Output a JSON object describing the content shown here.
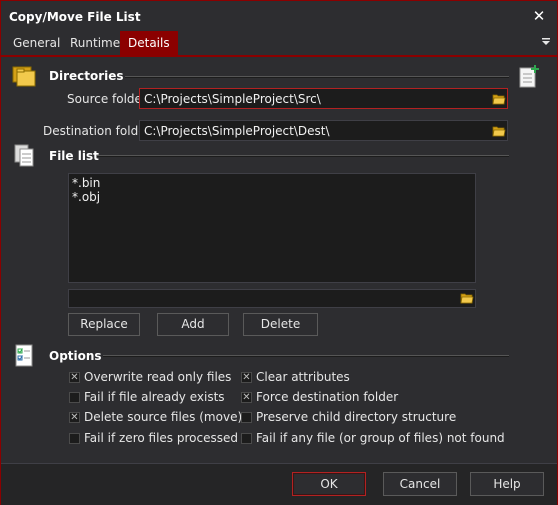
{
  "window": {
    "title": "Copy/Move File List",
    "close_glyph": "✕",
    "accent": "#8b0000"
  },
  "tabs": [
    {
      "label": "General"
    },
    {
      "label": "Runtime"
    },
    {
      "label": "Details"
    }
  ],
  "directories": {
    "title": "Directories",
    "source_label": "Source folder:",
    "source_value": "C:\\Projects\\SimpleProject\\Src\\",
    "dest_label": "Destination folder:",
    "dest_value": "C:\\Projects\\SimpleProject\\Dest\\"
  },
  "file_list": {
    "title": "File list",
    "items": [
      "*.bin",
      "*.obj"
    ],
    "entry_value": "",
    "replace_label": "Replace",
    "add_label": "Add",
    "delete_label": "Delete"
  },
  "options": {
    "title": "Options",
    "left": [
      {
        "label": "Overwrite read only files",
        "checked": true
      },
      {
        "label": "Fail if file already exists",
        "checked": false
      },
      {
        "label": "Delete source files (move)",
        "checked": true
      },
      {
        "label": "Fail if zero files processed",
        "checked": false
      }
    ],
    "right": [
      {
        "label": "Clear attributes",
        "checked": true
      },
      {
        "label": "Force destination folder",
        "checked": true
      },
      {
        "label": "Preserve child directory structure",
        "checked": false
      },
      {
        "label": "Fail if any file (or group of files) not found",
        "checked": false
      }
    ]
  },
  "footer": {
    "ok_label": "OK",
    "cancel_label": "Cancel",
    "help_label": "Help"
  },
  "icons": {
    "close": "close-icon",
    "tab_menu": "tab-menu-icon",
    "folders": "folders-icon",
    "new_item": "new-item-icon",
    "documents": "documents-icon",
    "checklist": "checklist-icon",
    "browse": "open-folder-icon",
    "check": "check-mark-icon"
  }
}
